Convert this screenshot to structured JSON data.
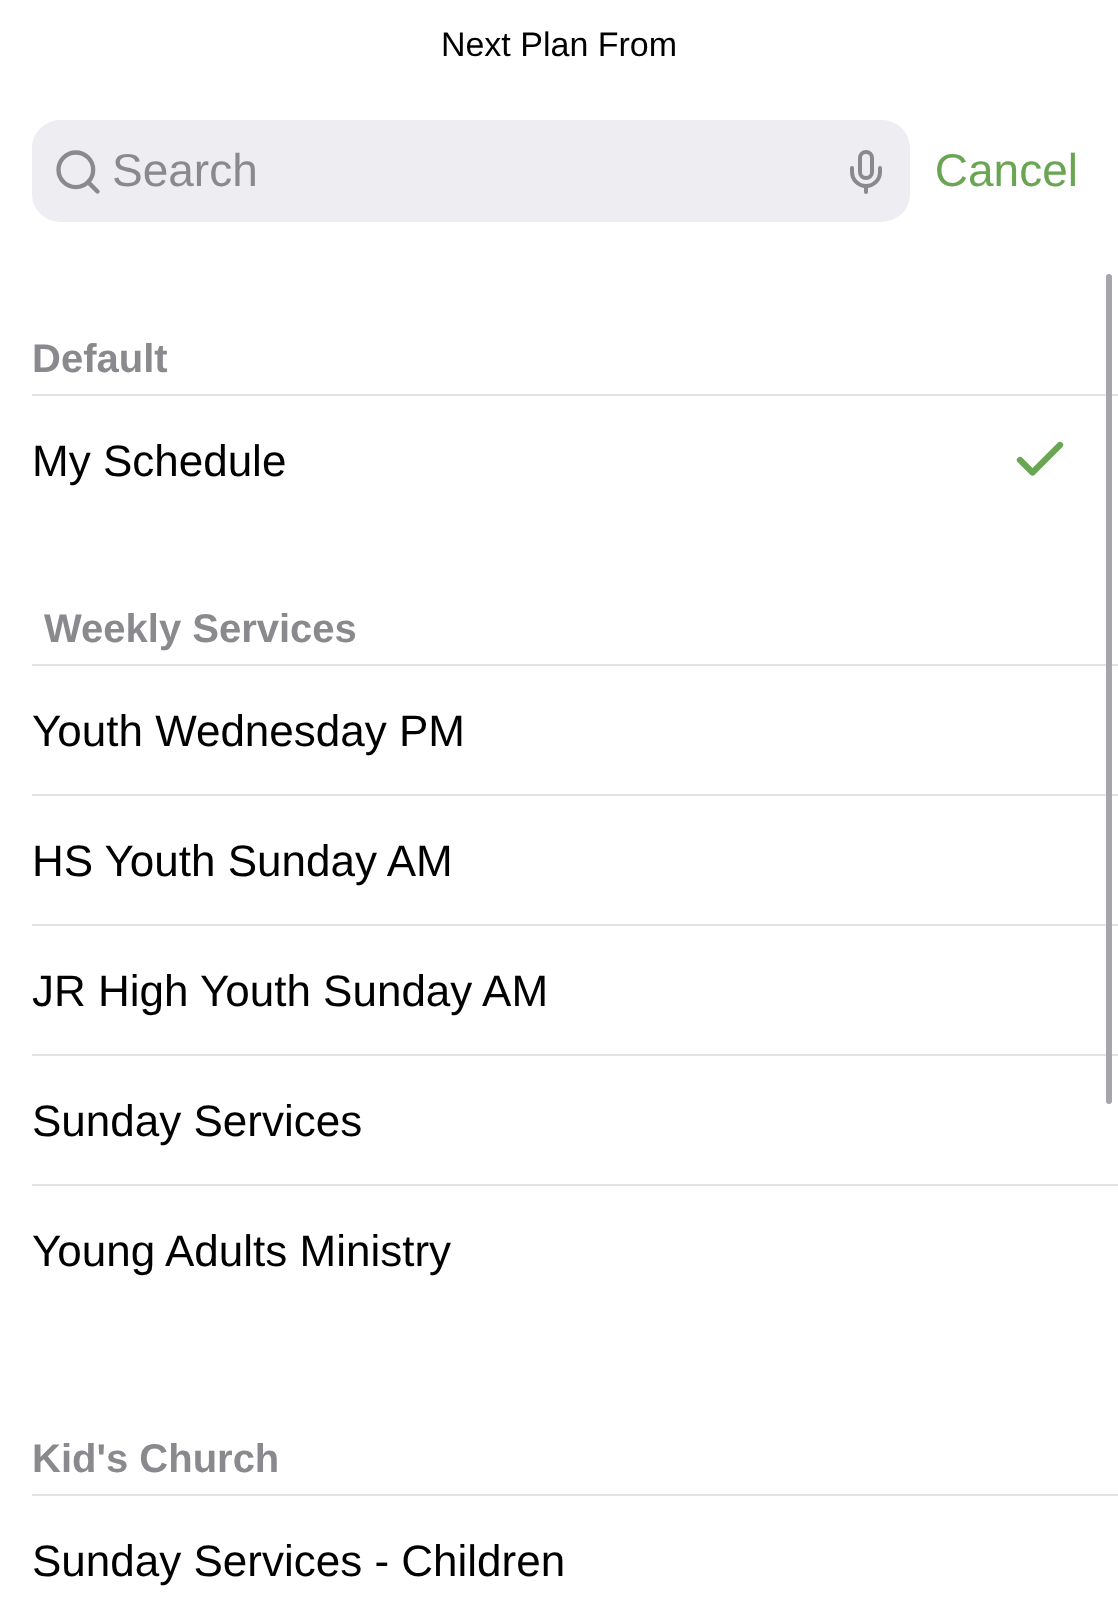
{
  "title": "Next Plan From",
  "search": {
    "placeholder": "Search"
  },
  "cancel": "Cancel",
  "sections": [
    {
      "header": "Default",
      "items": [
        {
          "label": "My Schedule",
          "selected": true
        }
      ]
    },
    {
      "header": "Weekly Services",
      "items": [
        {
          "label": "Youth Wednesday PM",
          "selected": false
        },
        {
          "label": "HS Youth Sunday AM",
          "selected": false
        },
        {
          "label": "JR High Youth Sunday AM",
          "selected": false
        },
        {
          "label": "Sunday Services",
          "selected": false
        },
        {
          "label": "Young Adults Ministry",
          "selected": false
        }
      ]
    },
    {
      "header": "Kid's Church",
      "items": [
        {
          "label": "Sunday Services - Children",
          "selected": false
        }
      ]
    }
  ]
}
